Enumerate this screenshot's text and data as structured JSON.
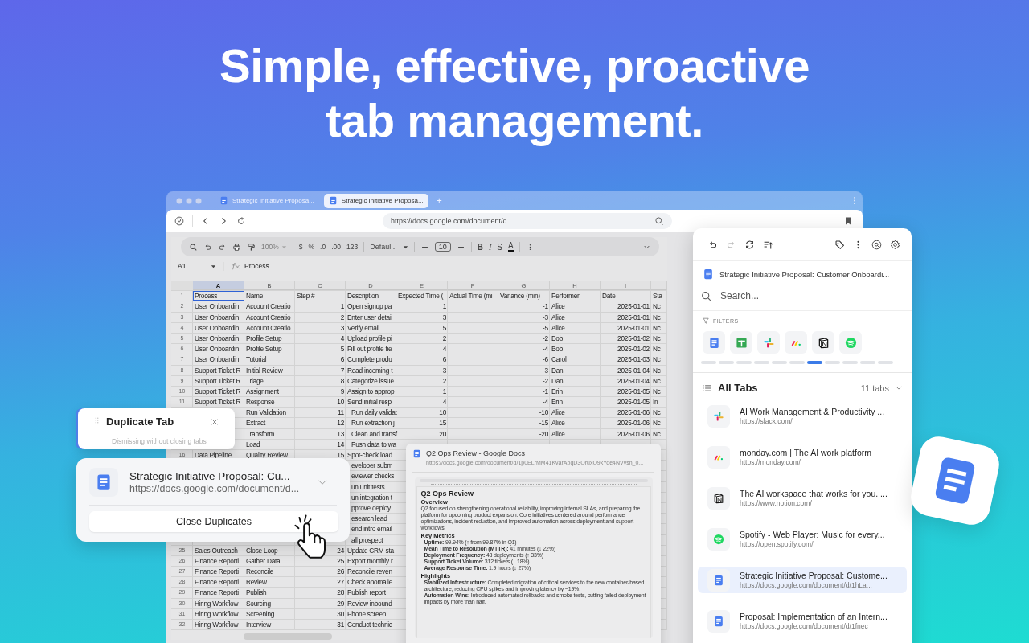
{
  "headline": "Simple, effective, proactive tab management.",
  "browser": {
    "tabs": [
      {
        "title": "Strategic Initiative Proposa...",
        "selected": false
      },
      {
        "title": "Strategic Initiative Proposa...",
        "selected": true
      }
    ],
    "new_tab": "+",
    "url": "https://docs.google.com/document/d..."
  },
  "sheet": {
    "toolbar": {
      "zoom": "100%",
      "currency": "$",
      "percent": "%",
      "decrease_decimals": ".0",
      "increase_decimals": ".00",
      "format": "123",
      "font": "Defaul...",
      "font_size": "10",
      "bold": "B",
      "italic": "I",
      "strike": "S",
      "text_color": "A"
    },
    "name_box": "A1",
    "formula": "Process",
    "columns": [
      {
        "label": "A",
        "selected": true
      },
      {
        "label": "B",
        "selected": false
      },
      {
        "label": "C",
        "selected": false
      },
      {
        "label": "D",
        "selected": false
      },
      {
        "label": "E",
        "selected": false
      },
      {
        "label": "F",
        "selected": false
      },
      {
        "label": "G",
        "selected": false
      },
      {
        "label": "H",
        "selected": false
      },
      {
        "label": "I",
        "selected": false
      }
    ],
    "rows": [
      {
        "num": "1",
        "cells": [
          "Process",
          "Name",
          "Step #",
          "Description",
          "Expected Time (",
          "Actual Time (mi",
          "Variance (min)",
          "Performer",
          "Date",
          "Sta"
        ]
      },
      {
        "num": "2",
        "cells": [
          "User Onboardin",
          "Account Creatio",
          "1",
          "Open signup pa",
          "1",
          null,
          "-1",
          "Alice",
          "2025-01-01",
          "Nc"
        ]
      },
      {
        "num": "3",
        "cells": [
          "User Onboardin",
          "Account Creatio",
          "2",
          "Enter user detail",
          "3",
          null,
          "-3",
          "Alice",
          "2025-01-01",
          "Nc"
        ]
      },
      {
        "num": "4",
        "cells": [
          "User Onboardin",
          "Account Creatio",
          "3",
          "Verify email",
          "5",
          null,
          "-5",
          "Alice",
          "2025-01-01",
          "Nc"
        ]
      },
      {
        "num": "5",
        "cells": [
          "User Onboardin",
          "Profile Setup",
          "4",
          "Upload profile pi",
          "2",
          null,
          "-2",
          "Bob",
          "2025-01-02",
          "Nc"
        ]
      },
      {
        "num": "6",
        "cells": [
          "User Onboardin",
          "Profile Setup",
          "5",
          "Fill out profile fie",
          "4",
          null,
          "-4",
          "Bob",
          "2025-01-02",
          "Nc"
        ]
      },
      {
        "num": "7",
        "cells": [
          "User Onboardin",
          "Tutorial",
          "6",
          "Complete produ",
          "6",
          null,
          "-6",
          "Carol",
          "2025-01-03",
          "Nc"
        ]
      },
      {
        "num": "8",
        "cells": [
          "Support Ticket R",
          "Initial Review",
          "7",
          "Read incoming t",
          "3",
          null,
          "-3",
          "Dan",
          "2025-01-04",
          "Nc"
        ]
      },
      {
        "num": "9",
        "cells": [
          "Support Ticket R",
          "Triage",
          "8",
          "Categorize issue",
          "2",
          null,
          "-2",
          "Dan",
          "2025-01-04",
          "Nc"
        ]
      },
      {
        "num": "10",
        "cells": [
          "Support Ticket R",
          "Assignment",
          "9",
          "Assign to approp",
          "1",
          null,
          "-1",
          "Erin",
          "2025-01-05",
          "Nc"
        ]
      },
      {
        "num": "11",
        "cells": [
          "Support Ticket R",
          "Response",
          "10",
          "Send initial resp",
          "4",
          null,
          "-4",
          "Erin",
          "2025-01-05",
          "In"
        ]
      },
      {
        "num": null,
        "cells": [
          null,
          "Run Validation",
          "11",
          "Run daily validat",
          "10",
          null,
          "-10",
          "Alice",
          "2025-01-06",
          "Nc"
        ]
      },
      {
        "num": null,
        "cells": [
          null,
          "Extract",
          "12",
          "Run extraction j",
          "15",
          null,
          "-15",
          "Alice",
          "2025-01-06",
          "Nc"
        ]
      },
      {
        "num": null,
        "cells": [
          null,
          "Transform",
          "13",
          "Clean and transf",
          "20",
          null,
          "-20",
          "Alice",
          "2025-01-06",
          "Nc"
        ]
      },
      {
        "num": null,
        "cells": [
          null,
          "Load",
          "14",
          "Push data to wa",
          null,
          null,
          null,
          null,
          null,
          null
        ]
      },
      {
        "num": "16",
        "cells": [
          "Data Pipeline",
          "Quality Review",
          "15",
          "Spot-check load",
          null,
          null,
          null,
          null,
          null,
          null
        ]
      },
      {
        "num": null,
        "cells": [
          null,
          null,
          null,
          "eveloper subm",
          null,
          null,
          null,
          null,
          null,
          null
        ]
      },
      {
        "num": null,
        "cells": [
          null,
          null,
          null,
          "eviewer checks",
          null,
          null,
          null,
          null,
          null,
          null
        ]
      },
      {
        "num": null,
        "cells": [
          null,
          null,
          null,
          "un unit tests",
          null,
          null,
          null,
          null,
          null,
          null
        ]
      },
      {
        "num": null,
        "cells": [
          null,
          null,
          null,
          "un integration t",
          null,
          null,
          null,
          null,
          null,
          null
        ]
      },
      {
        "num": null,
        "cells": [
          null,
          null,
          null,
          "pprove deploy",
          null,
          null,
          null,
          null,
          null,
          null
        ]
      },
      {
        "num": null,
        "cells": [
          null,
          null,
          null,
          "esearch lead",
          null,
          null,
          null,
          null,
          null,
          null
        ]
      },
      {
        "num": null,
        "cells": [
          null,
          null,
          null,
          "end intro email",
          null,
          null,
          null,
          null,
          null,
          null
        ]
      },
      {
        "num": null,
        "cells": [
          null,
          null,
          null,
          "all prospect",
          null,
          null,
          null,
          null,
          null,
          null
        ]
      },
      {
        "num": "25",
        "cells": [
          "Sales Outreach",
          "Close Loop",
          "24",
          "Update CRM sta",
          null,
          null,
          null,
          null,
          null,
          null
        ]
      },
      {
        "num": "26",
        "cells": [
          "Finance Reporti",
          "Gather Data",
          "25",
          "Export monthly r",
          null,
          null,
          null,
          null,
          null,
          null
        ]
      },
      {
        "num": "27",
        "cells": [
          "Finance Reporti",
          "Reconcile",
          "26",
          "Reconcile reven",
          null,
          null,
          null,
          null,
          null,
          null
        ]
      },
      {
        "num": "28",
        "cells": [
          "Finance Reporti",
          "Review",
          "27",
          "Check anomalie",
          null,
          null,
          null,
          null,
          null,
          null
        ]
      },
      {
        "num": "29",
        "cells": [
          "Finance Reporti",
          "Publish",
          "28",
          "Publish report",
          null,
          null,
          null,
          null,
          null,
          null
        ]
      },
      {
        "num": "30",
        "cells": [
          "Hiring Workflow",
          "Sourcing",
          "29",
          "Review inbound",
          null,
          null,
          null,
          null,
          null,
          null
        ]
      },
      {
        "num": "31",
        "cells": [
          "Hiring Workflow",
          "Screening",
          "30",
          "Phone screen",
          null,
          null,
          null,
          null,
          null,
          null
        ]
      },
      {
        "num": "32",
        "cells": [
          "Hiring Workflow",
          "Interview",
          "31",
          "Conduct technic",
          null,
          null,
          null,
          null,
          null,
          null
        ]
      }
    ]
  },
  "duplicate_popup": {
    "title": "Duplicate Tab",
    "hint": "Dismissing without closing tabs",
    "tab": {
      "kind": "docs",
      "title": "Strategic Initiative Proposal: Cu...",
      "url": "https://docs.google.com/document/d..."
    },
    "action": "Close Duplicates"
  },
  "preview": {
    "kind": "docs",
    "title": "Q2 Ops Review - Google Docs",
    "url": "https://docs.google.com/document/d/1p0ELrMM41KvarAbqD3OruxO9kYqe4NVvsh_0...",
    "doc": {
      "title": "Q2 Ops Review",
      "sections": [
        {
          "heading": "Overview",
          "paragraph": "Q2 focused on strengthening operational reliability, improving internal SLAs, and preparing the platform for upcoming product expansion. Core initiatives centered around performance optimizations, incident reduction, and improved automation across deployment and support workflows."
        },
        {
          "heading": "Key Metrics",
          "bullets": [
            "**Uptime:** 99.94% (↑ from 99.87% in Q1)",
            "**Mean Time to Resolution (MTTR):** 41 minutes (↓ 22%)",
            "**Deployment Frequency:** 48 deployments (↑ 33%)",
            "**Support Ticket Volume:** 312 tickets (↓ 18%)",
            "**Average Response Time:** 1.9 hours (↓ 27%)"
          ]
        },
        {
          "heading": "Highlights",
          "bullets": [
            "**Stabilized Infrastructure:** Completed migration of critical services to the new container-based architecture, reducing CPU spikes and improving latency by ~19%.",
            "**Automation Wins:** Introduced automated rollbacks and smoke tests, cutting failed deployment impacts by more than half."
          ]
        }
      ]
    }
  },
  "panel": {
    "current": {
      "kind": "docs",
      "title": "Strategic Initiative Proposal: Customer Onboardi..."
    },
    "search": {
      "placeholder": "Search..."
    },
    "filters_label": "FILTERS",
    "filters": [
      {
        "kind": "docs"
      },
      {
        "kind": "sheets"
      },
      {
        "kind": "slack"
      },
      {
        "kind": "monday"
      },
      {
        "kind": "notion"
      },
      {
        "kind": "spotify"
      }
    ],
    "filter_pages": [
      {
        "selected": false
      },
      {
        "selected": false
      },
      {
        "selected": false
      },
      {
        "selected": false
      },
      {
        "selected": false
      },
      {
        "selected": false
      },
      {
        "selected": true
      },
      {
        "selected": false
      },
      {
        "selected": false
      },
      {
        "selected": false
      },
      {
        "selected": false
      }
    ],
    "list_title": "All Tabs",
    "count": "11 tabs",
    "tabs": [
      {
        "kind": "slack",
        "title": "AI Work Management & Productivity ...",
        "url": "https://slack.com/",
        "selected": false
      },
      {
        "kind": "monday",
        "title": "monday.com | The AI work platform",
        "url": "https://monday.com/",
        "selected": false
      },
      {
        "kind": "notion",
        "title": "The AI workspace that works for you. ...",
        "url": "https://www.notion.com/",
        "selected": false
      },
      {
        "kind": "spotify",
        "title": "Spotify - Web Player: Music for every...",
        "url": "https://open.spotify.com/",
        "selected": false
      },
      {
        "kind": "docs",
        "title": "Strategic Initiative Proposal: Custome...",
        "url": "https://docs.google.com/document/d/1hLa...",
        "selected": true
      },
      {
        "kind": "docs",
        "title": "Proposal: Implementation of an Intern...",
        "url": "https://docs.google.com/document/d/1fnec",
        "selected": false
      }
    ]
  }
}
